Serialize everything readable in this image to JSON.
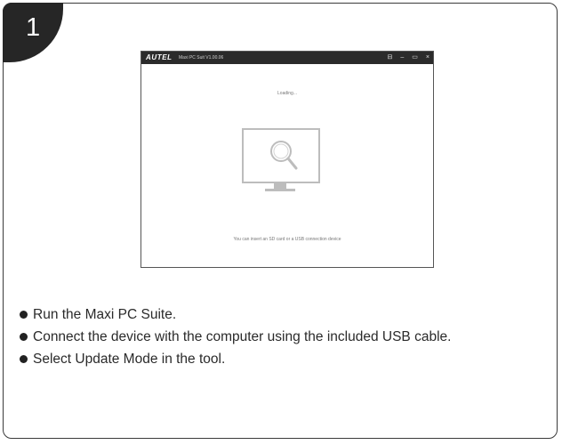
{
  "step": {
    "number": "1"
  },
  "app_window": {
    "logo": "AUTEL",
    "title": "Maxi PC Suit V1.00.06",
    "controls": {
      "restore_icon": "⊟",
      "minimize_icon": "–",
      "maximize_icon": "▭",
      "close_icon": "×"
    },
    "loading_text": "Loading...",
    "hint_text": "You can insert an SD card or a USB connection device",
    "monitor_icon": "monitor-with-magnifier-icon"
  },
  "instructions": [
    {
      "prefix": "Run the ",
      "emphasis": "Maxi PC Suite",
      "suffix": "."
    },
    {
      "prefix": "Connect the device with the computer using the included USB cable.",
      "emphasis": "",
      "suffix": ""
    },
    {
      "prefix": "Select ",
      "emphasis": "Update Mode",
      "suffix": " in the tool."
    }
  ],
  "colors": {
    "badge": "#262626",
    "titlebar": "#2b2b2b",
    "monitor": "#bdbdbd"
  }
}
